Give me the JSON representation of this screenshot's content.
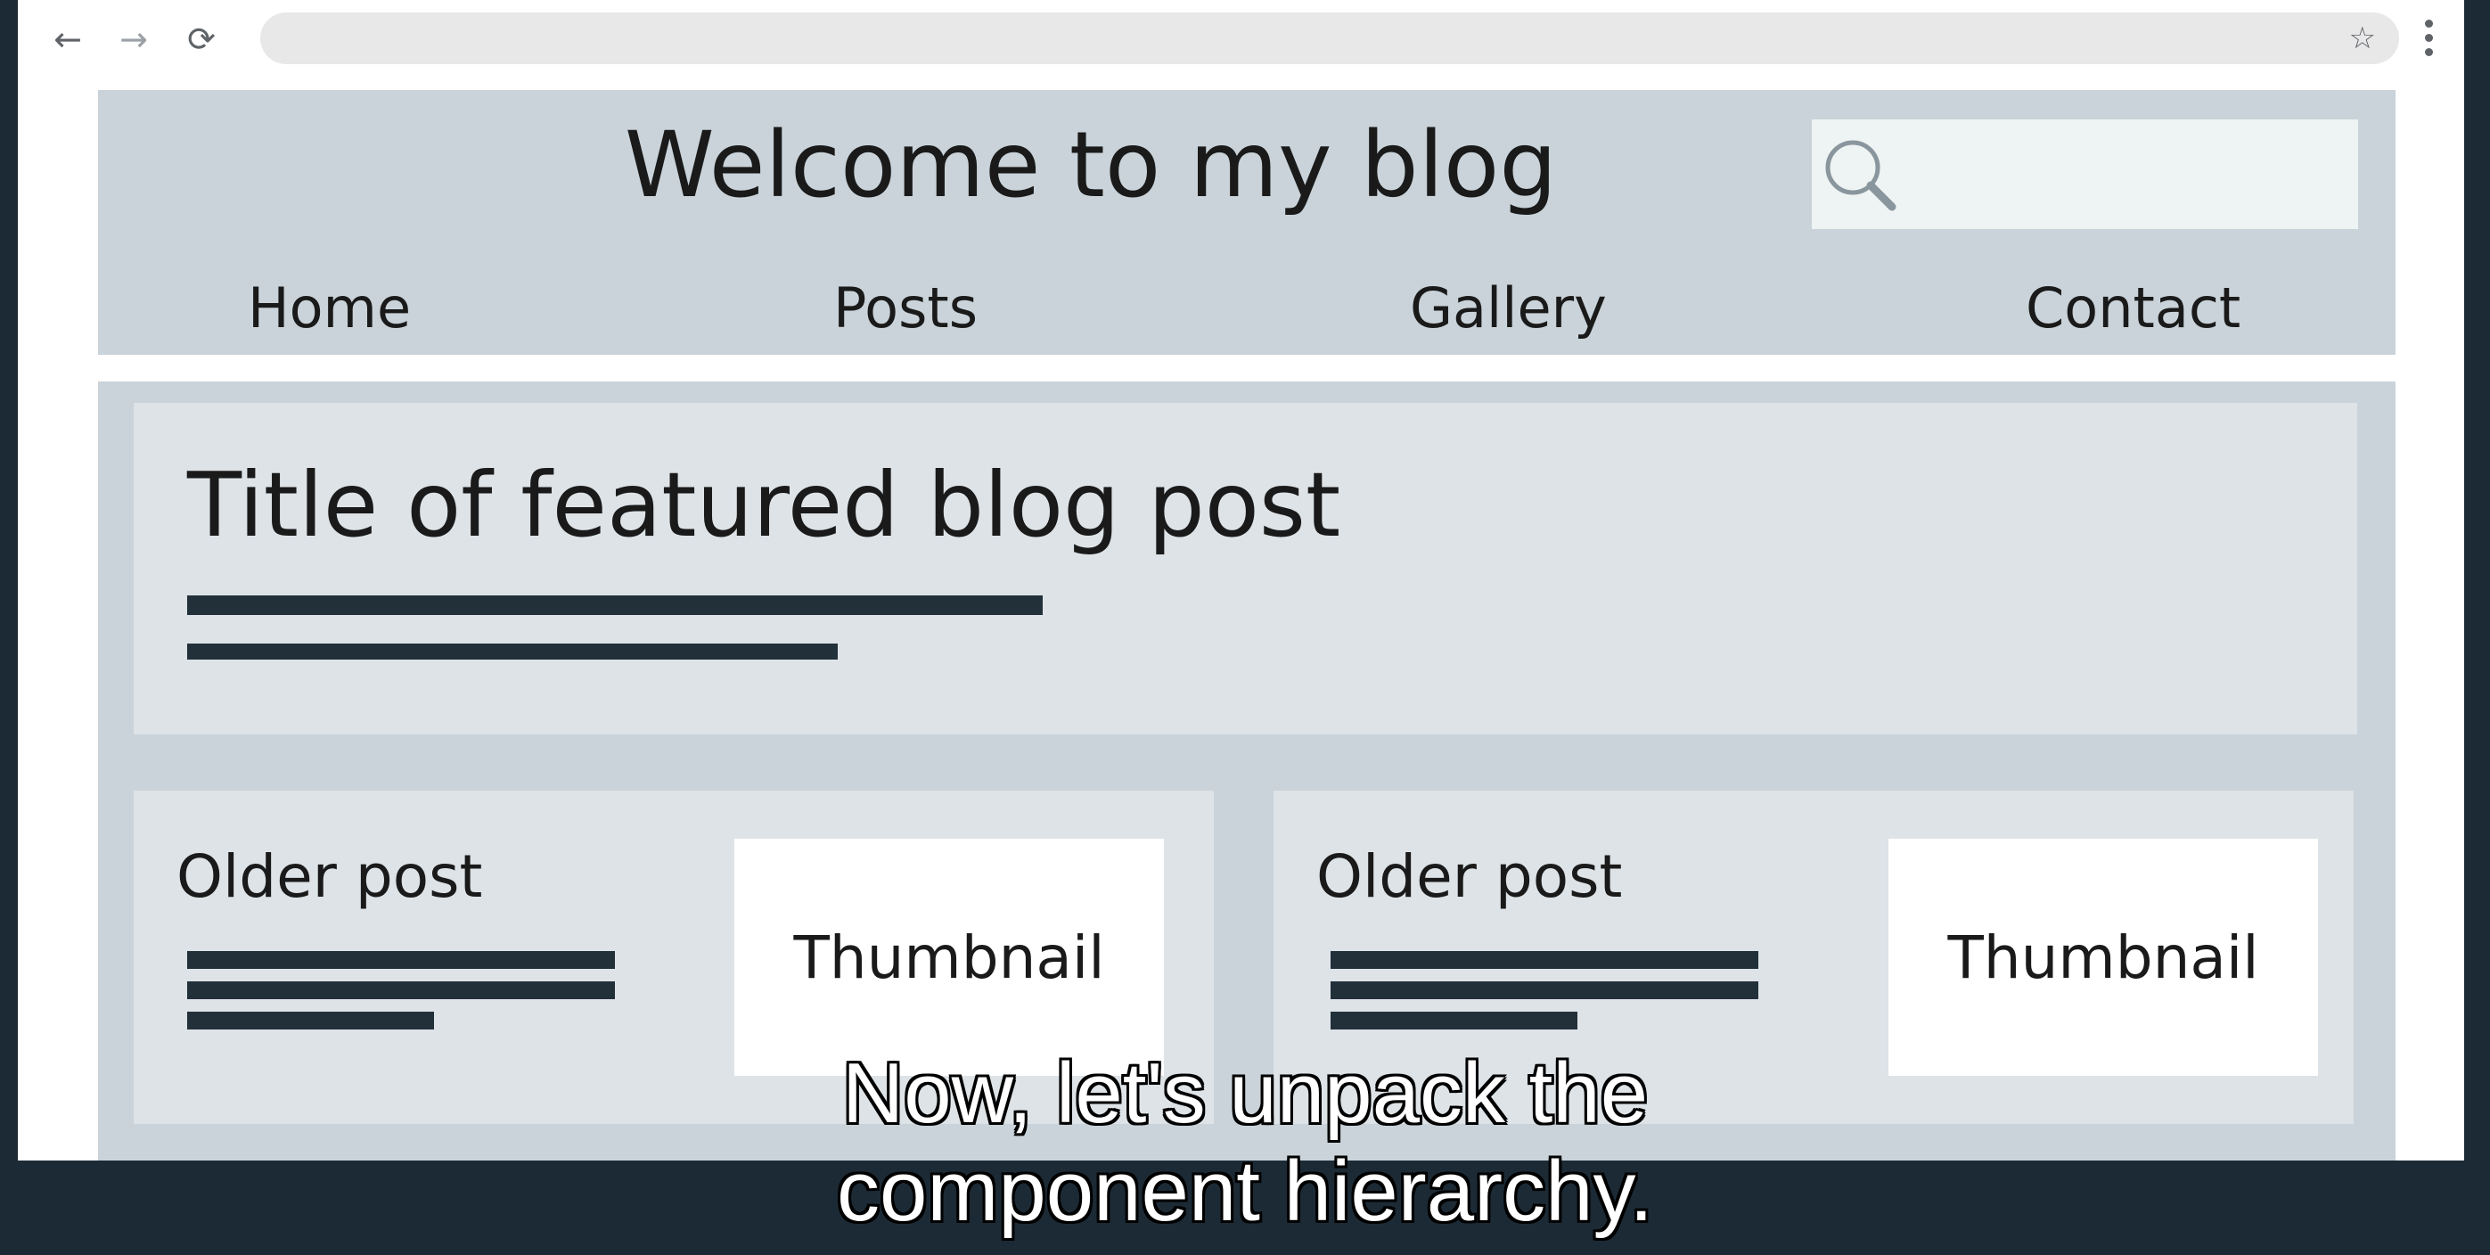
{
  "browser": {
    "icons": {
      "back": "arrow-left-icon",
      "forward": "arrow-right-icon",
      "reload": "reload-icon",
      "bookmark": "star-icon",
      "menu": "more-vertical-icon"
    }
  },
  "blog": {
    "title": "Welcome to my blog",
    "search": {
      "icon": "search-icon",
      "placeholder": ""
    },
    "nav": [
      "Home",
      "Posts",
      "Gallery",
      "Contact"
    ],
    "featured": {
      "title": "Title of featured blog post"
    },
    "older_posts": [
      {
        "title": "Older post",
        "thumbnail": "Thumbnail"
      },
      {
        "title": "Older post",
        "thumbnail": "Thumbnail"
      }
    ]
  },
  "caption": {
    "line1": "Now, let's unpack the",
    "line2": "component hierarchy."
  },
  "colors": {
    "page_background": "#1c2a35",
    "header_background": "#c9d3d9",
    "card_background": "#dde3e7",
    "text_line": "#22303a"
  }
}
